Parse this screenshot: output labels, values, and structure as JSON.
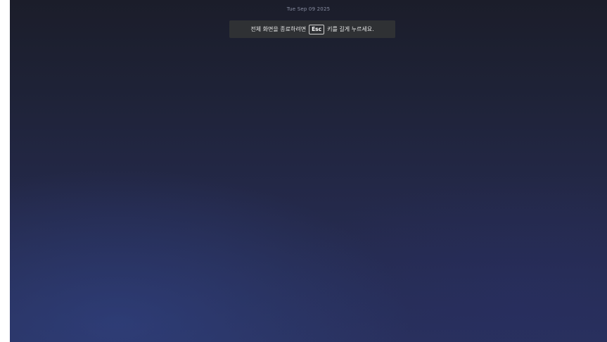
{
  "clock": {
    "datetime": "Tue Sep 09 2025"
  },
  "fullscreen_banner": {
    "text_before": "전체 화면을 종료하려면",
    "key_label": "Esc",
    "text_after": "키를 길게 누르세요."
  }
}
